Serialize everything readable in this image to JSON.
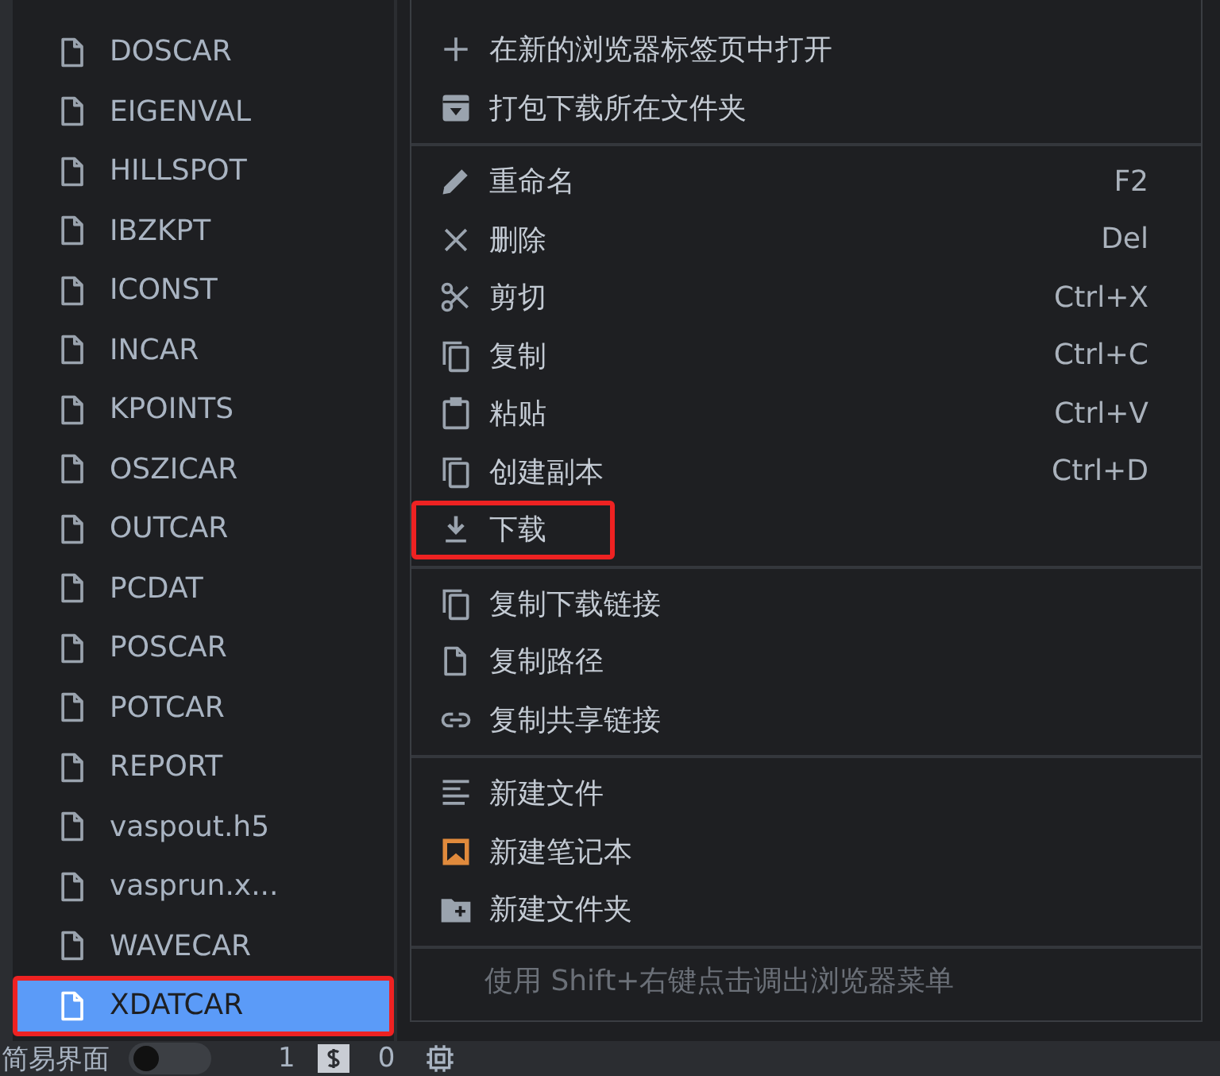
{
  "file_list": [
    {
      "name": "DOSCAR",
      "selected": false,
      "annotated": false
    },
    {
      "name": "EIGENVAL",
      "selected": false,
      "annotated": false
    },
    {
      "name": "HILLSPOT",
      "selected": false,
      "annotated": false
    },
    {
      "name": "IBZKPT",
      "selected": false,
      "annotated": false
    },
    {
      "name": "ICONST",
      "selected": false,
      "annotated": false
    },
    {
      "name": "INCAR",
      "selected": false,
      "annotated": false
    },
    {
      "name": "KPOINTS",
      "selected": false,
      "annotated": false
    },
    {
      "name": "OSZICAR",
      "selected": false,
      "annotated": false
    },
    {
      "name": "OUTCAR",
      "selected": false,
      "annotated": false
    },
    {
      "name": "PCDAT",
      "selected": false,
      "annotated": false
    },
    {
      "name": "POSCAR",
      "selected": false,
      "annotated": false
    },
    {
      "name": "POTCAR",
      "selected": false,
      "annotated": false
    },
    {
      "name": "REPORT",
      "selected": false,
      "annotated": false
    },
    {
      "name": "vaspout.h5",
      "selected": false,
      "annotated": false
    },
    {
      "name": "vasprun.x...",
      "selected": false,
      "annotated": false
    },
    {
      "name": "WAVECAR",
      "selected": false,
      "annotated": false
    },
    {
      "name": "XDATCAR",
      "selected": true,
      "annotated": true
    }
  ],
  "context_menu": {
    "sections": [
      [
        {
          "kind": "plus",
          "label": "在新的浏览器标签页中打开",
          "annotated": false
        },
        {
          "kind": "archive",
          "label": "打包下载所在文件夹",
          "annotated": false
        }
      ],
      [
        {
          "kind": "pencil",
          "label": "重命名",
          "shortcut": "F2",
          "annotated": false
        },
        {
          "kind": "close",
          "label": "删除",
          "shortcut": "Del",
          "annotated": false
        },
        {
          "kind": "scissors",
          "label": "剪切",
          "shortcut": "Ctrl+X",
          "annotated": false
        },
        {
          "kind": "copy",
          "label": "复制",
          "shortcut": "Ctrl+C",
          "annotated": false
        },
        {
          "kind": "clipboard",
          "label": "粘贴",
          "shortcut": "Ctrl+V",
          "annotated": false
        },
        {
          "kind": "copy",
          "label": "创建副本",
          "shortcut": "Ctrl+D",
          "annotated": false
        },
        {
          "kind": "download",
          "label": "下载",
          "annotated": true
        }
      ],
      [
        {
          "kind": "copy",
          "label": "复制下载链接",
          "annotated": false
        },
        {
          "kind": "file",
          "label": "复制路径",
          "annotated": false
        },
        {
          "kind": "link",
          "label": "复制共享链接",
          "annotated": false
        }
      ],
      [
        {
          "kind": "lines",
          "label": "新建文件",
          "annotated": false
        },
        {
          "kind": "bookmark",
          "label": "新建笔记本",
          "annotated": false
        },
        {
          "kind": "folder-plus",
          "label": "新建文件夹",
          "annotated": false
        }
      ]
    ],
    "hint": "使用 Shift+右键点击调出浏览器菜单"
  },
  "status_bar": {
    "mode_label": "简易界面",
    "simple_mode_on": false,
    "count_1": "1",
    "count_2": "0"
  }
}
